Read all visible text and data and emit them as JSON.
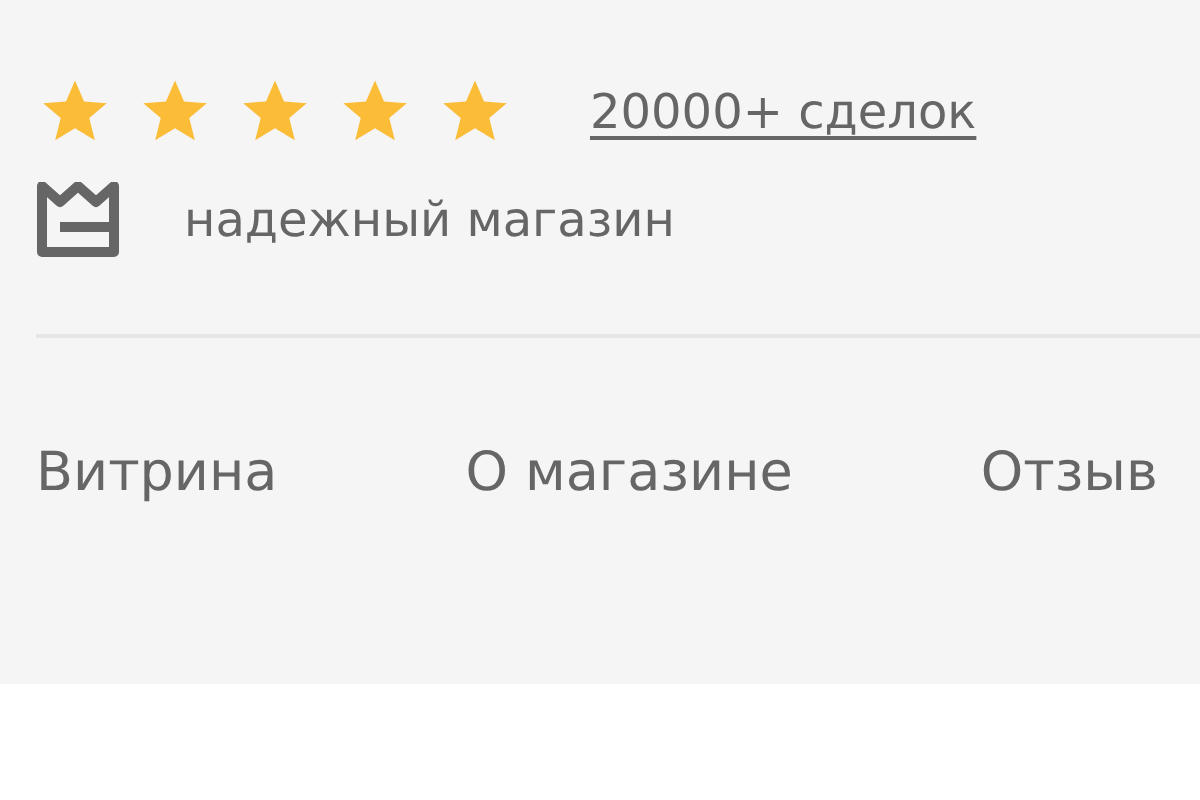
{
  "rating": {
    "stars": 5,
    "deals_link": "20000+ сделок"
  },
  "badge": {
    "label": "надежный магазин"
  },
  "tabs": [
    {
      "label": "Витрина"
    },
    {
      "label": "О магазине"
    },
    {
      "label": "Отзыв"
    }
  ]
}
